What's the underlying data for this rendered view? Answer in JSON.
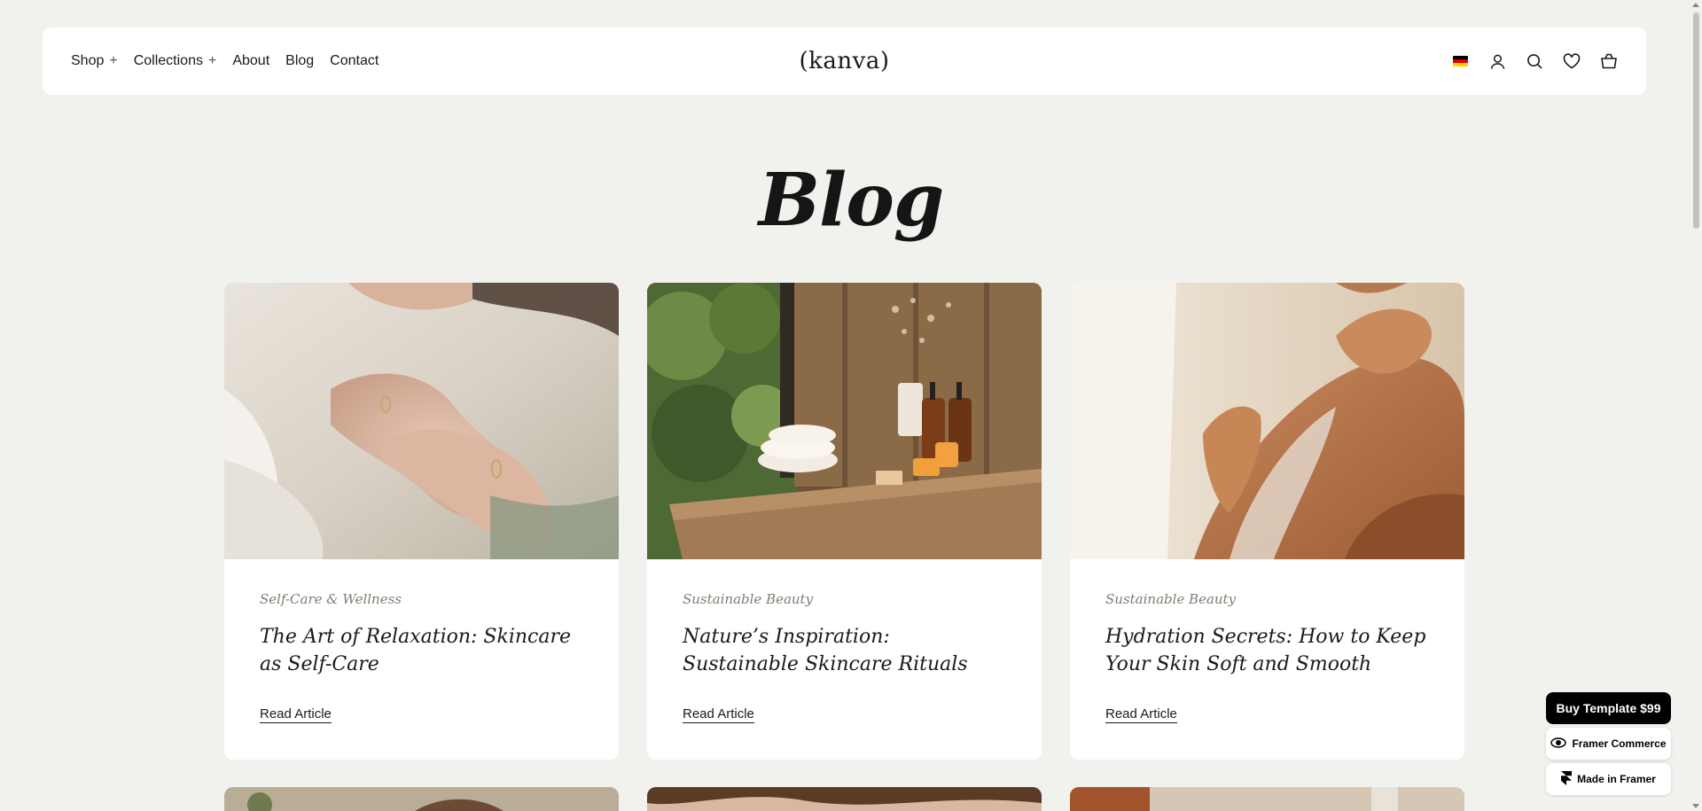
{
  "header": {
    "nav": [
      {
        "label": "Shop",
        "plus": "+"
      },
      {
        "label": "Collections",
        "plus": "+"
      },
      {
        "label": "About",
        "plus": ""
      },
      {
        "label": "Blog",
        "plus": ""
      },
      {
        "label": "Contact",
        "plus": ""
      }
    ],
    "logo": "(kanva)",
    "icons": [
      "germany-flag-icon",
      "user-icon",
      "search-icon",
      "heart-icon",
      "bag-icon"
    ]
  },
  "page": {
    "title": "Blog"
  },
  "articles": [
    {
      "category": "Self-Care & Wellness",
      "title": "The Art of Relaxation: Skincare as Self-Care",
      "link": "Read Article"
    },
    {
      "category": "Sustainable Beauty",
      "title": "Nature’s Inspiration: Sustainable Skincare Rituals",
      "link": "Read Article"
    },
    {
      "category": "Sustainable Beauty",
      "title": "Hydration Secrets: How to Keep Your Skin Soft and Smooth",
      "link": "Read Article"
    }
  ],
  "badges": {
    "buy": "Buy Template $99",
    "commerce": "Framer Commerce",
    "made": "Made in Framer"
  },
  "colors": {
    "background": "#f1f1ed",
    "card": "#ffffff",
    "category_text": "#7a7f70",
    "buy_badge": "#000000"
  }
}
